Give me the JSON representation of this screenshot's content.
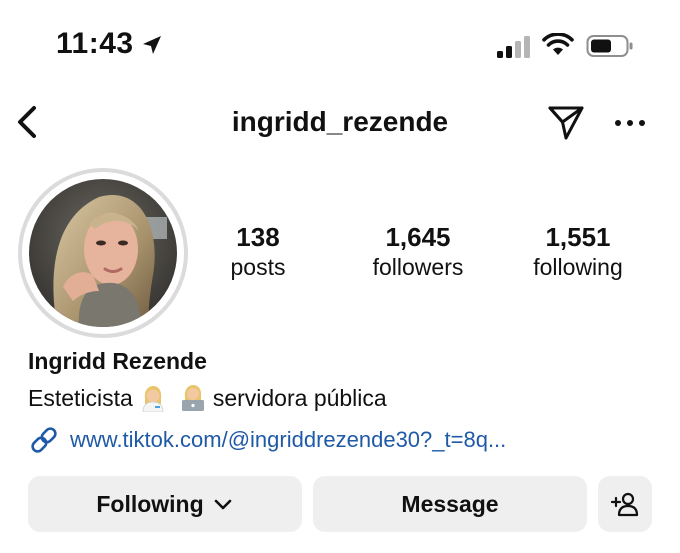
{
  "status_bar": {
    "time": "11:43",
    "icons": [
      "location-arrow-icon",
      "cellular-signal-icon",
      "wifi-icon",
      "battery-icon"
    ]
  },
  "header": {
    "username": "ingridd_rezende",
    "icons": [
      "back-chevron-icon",
      "send-paper-plane-icon",
      "more-ellipsis-icon"
    ]
  },
  "profile": {
    "stats": {
      "posts_count": "138",
      "posts_label": "posts",
      "followers_count": "1,645",
      "followers_label": "followers",
      "following_count": "1,551",
      "following_label": "following"
    },
    "name": "Ingridd Rezende",
    "bio_part1": "Esteticista",
    "bio_part2": "servidora pública",
    "bio_emojis": [
      "woman-health-worker-emoji",
      "woman-technologist-emoji"
    ],
    "link": "www.tiktok.com/@ingriddrezende30?_t=8q..."
  },
  "actions": {
    "following_label": "Following",
    "message_label": "Message"
  },
  "colors": {
    "link": "#1f5aa6",
    "button_bg": "#efefef",
    "avatar_ring": "#dbdbdb"
  }
}
